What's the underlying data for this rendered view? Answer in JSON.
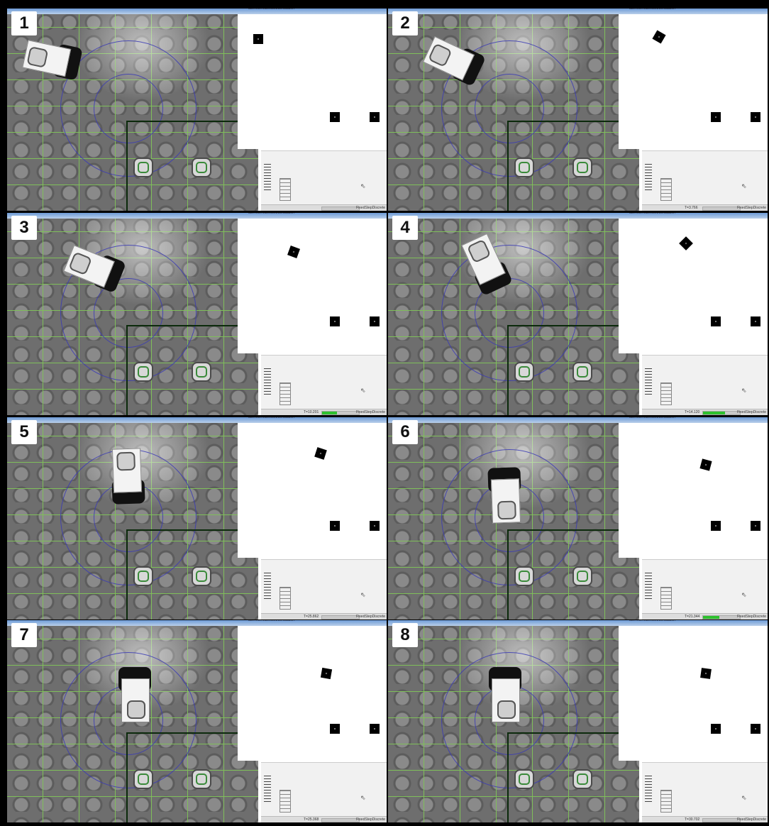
{
  "window_title": "advroot/multirobot/Simulation",
  "status_label": "FixedStepDiscrete",
  "panels": [
    {
      "number": "1",
      "time": "",
      "progress": 0
    },
    {
      "number": "2",
      "time": "T=3.766",
      "progress": 0
    },
    {
      "number": "3",
      "time": "T=10.201",
      "progress": 0.4
    },
    {
      "number": "4",
      "time": "T=14.120",
      "progress": 0.6
    },
    {
      "number": "5",
      "time": "T=25.862",
      "progress": 0
    },
    {
      "number": "6",
      "time": "T=21.344",
      "progress": 0.45
    },
    {
      "number": "7",
      "time": "T=25.368",
      "progress": 0
    },
    {
      "number": "8",
      "time": "T=30.702",
      "progress": 0
    }
  ],
  "colors": {
    "grid": "#7fbf5a",
    "ring": "#3b3bb5",
    "progress": "#2ec12e"
  }
}
